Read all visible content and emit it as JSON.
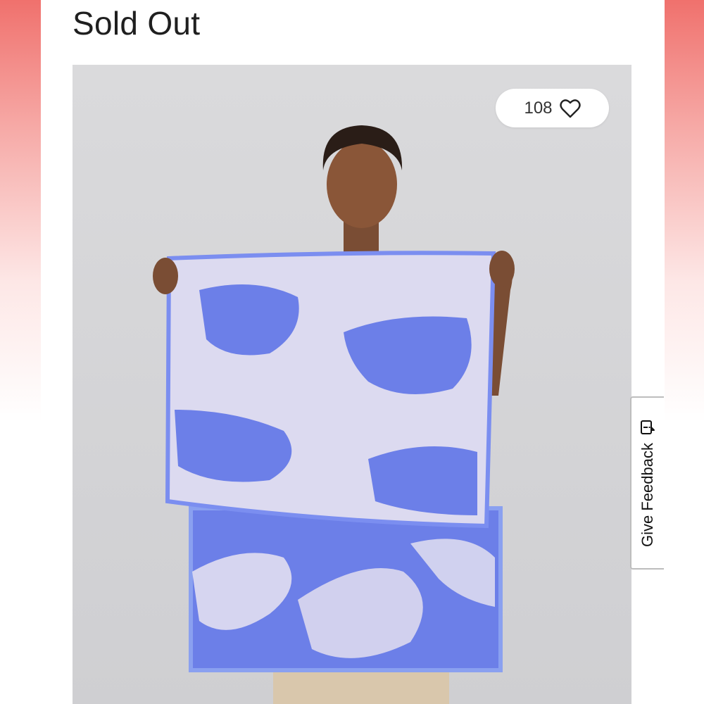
{
  "product": {
    "status_label": "Sold Out"
  },
  "likes": {
    "count": "108",
    "icon": "heart-outline-icon"
  },
  "feedback": {
    "label": "Give Feedback",
    "icon": "feedback-icon"
  },
  "theme": {
    "accent_side": "#f0716d",
    "towel_blue": "#6c7fe8",
    "towel_cloud": "#dcdaf0"
  }
}
